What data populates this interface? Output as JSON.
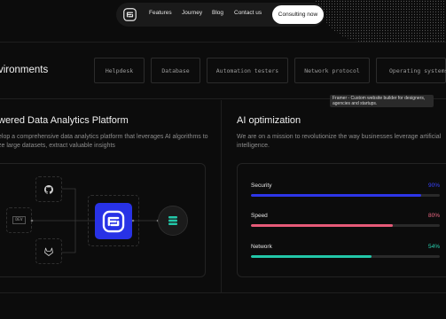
{
  "nav": {
    "links": [
      "Features",
      "Journey",
      "Blog",
      "Contact us"
    ],
    "cta": "Consulting now"
  },
  "environments": {
    "title": "vironments",
    "chips": [
      "Helpdesk",
      "Database",
      "Automation testers",
      "Network protocol",
      "Operating systems"
    ]
  },
  "tooltip": {
    "text": "Framer - Custom website builder for designers, agencies and startups."
  },
  "analytics": {
    "title": "wered Data Analytics Platform",
    "description_line1": "elop a comprehensive data analytics platform that leverages AI algorithms to",
    "description_line2": "ze large datasets, extract valuable insights",
    "dev_label": "DEV"
  },
  "ai": {
    "title": "AI optimization",
    "description_line1": "We are on a mission to revolutionize the way businesses leverage artificial",
    "description_line2": "intelligence.",
    "metrics": [
      {
        "label": "Security",
        "value": "90%",
        "fraction": 0.9,
        "color": "#2d35e8",
        "text_color": "#3a44ff"
      },
      {
        "label": "Speed",
        "value": "80%",
        "fraction": 0.75,
        "color": "#e65a78",
        "text_color": "#f06a85"
      },
      {
        "label": "Network",
        "value": "54%",
        "fraction": 0.64,
        "color": "#22c7a8",
        "text_color": "#28d3b2"
      }
    ]
  }
}
